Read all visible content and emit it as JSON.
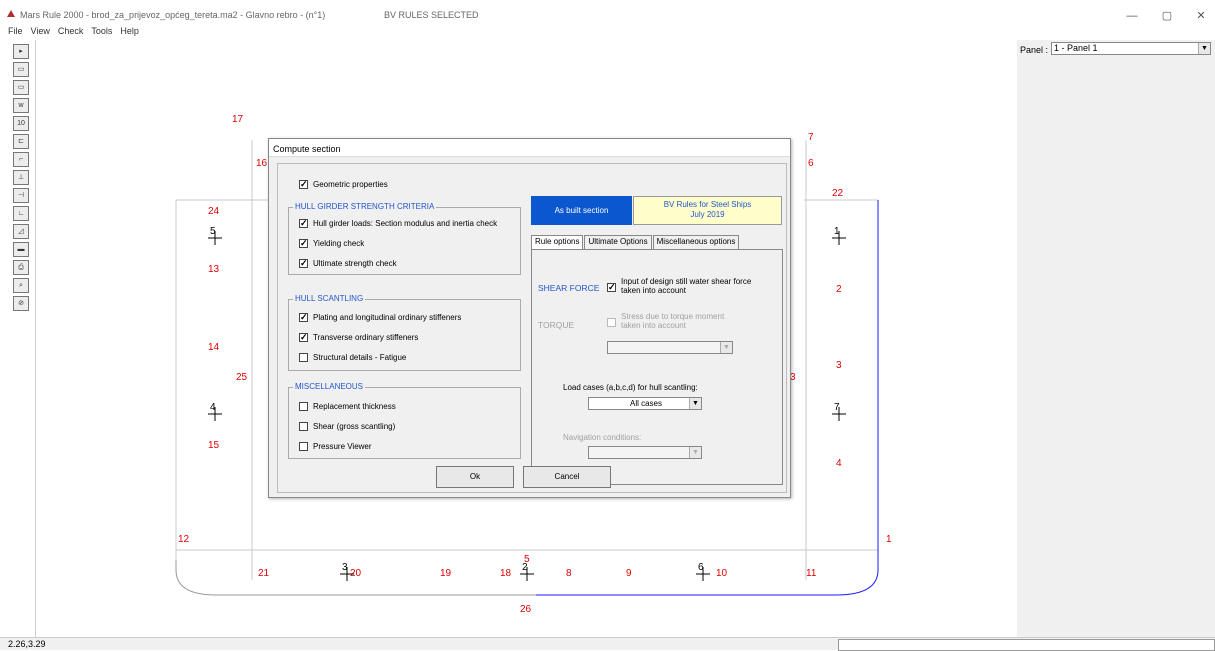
{
  "window": {
    "title": "Mars Rule 2000 - brod_za_prijevoz_općeg_tereta.ma2 - Glavno rebro - (n°1)",
    "rules_selected": "BV RULES SELECTED",
    "minimize": "—",
    "maximize": "▢",
    "close": "✕"
  },
  "menu": [
    "File",
    "View",
    "Check",
    "Tools",
    "Help"
  ],
  "toolbar": {
    "icons": [
      "play-icon",
      "stiffener-icon",
      "stiffener-icon",
      "weight-icon",
      "scale-icon",
      "e-profile-icon",
      "angle-icon",
      "bulb-icon",
      "tee-icon",
      "knee-icon",
      "hull-icon",
      "flat-icon",
      "bracket-icon",
      "box-icon",
      "print-icon",
      "zoom-icon",
      "no-zoom-icon"
    ]
  },
  "panel": {
    "label": "Panel :",
    "value": "1 - Panel 1"
  },
  "status": {
    "coords": "2.26,3.29"
  },
  "drawing": {
    "labels": [
      "17",
      "16",
      "24",
      "5",
      "13",
      "14",
      "25",
      "4",
      "15",
      "12",
      "7",
      "6",
      "22",
      "1",
      "2",
      "3",
      "7",
      "4",
      "1",
      "21",
      "3",
      "20",
      "19",
      "18",
      "2",
      "5",
      "8",
      "9",
      "6",
      "10",
      "11",
      "26",
      "3"
    ]
  },
  "dialog": {
    "title": "Compute section",
    "geometric_properties": "Geometric properties",
    "hull_girder_group": "HULL GIRDER STRENGTH CRITERIA",
    "hull_girder_loads": "Hull girder loads: Section modulus and inertia check",
    "yielding_check": "Yielding check",
    "ultimate_strength_check": "Ultimate strength check",
    "hull_scantling_group": "HULL SCANTLING",
    "plating_stiffeners": "Plating and longitudinal ordinary stiffeners",
    "transverse_stiffeners": "Transverse ordinary stiffeners",
    "structural_details": "Structural details  -  Fatigue",
    "misc_group": "MISCELLANEOUS",
    "replacement_thickness": "Replacement thickness",
    "shear_gross": "Shear (gross scantling)",
    "pressure_viewer": "Pressure Viewer",
    "as_built": "As built section",
    "bv_rules_line1": "BV Rules for Steel Ships",
    "bv_rules_line2": "July 2019",
    "tabs": [
      "Rule options",
      "Ultimate Options",
      "Miscellaneous options"
    ],
    "shear_force_label": "SHEAR FORCE",
    "shear_force_option_l1": "Input of design still water shear force",
    "shear_force_option_l2": "taken into account",
    "torque_label": "TORQUE",
    "torque_option_l1": "Stress due to torque moment",
    "torque_option_l2": "taken into account",
    "load_cases_label": "Load cases (a,b,c,d) for hull scantling:",
    "load_cases_value": "All cases",
    "nav_conditions_label": "Navigation conditions:",
    "ok": "Ok",
    "cancel": "Cancel"
  },
  "checkboxes": {
    "geometric_properties": true,
    "hull_girder_loads": true,
    "yielding_check": true,
    "ultimate_strength_check": true,
    "plating_stiffeners": true,
    "transverse_stiffeners": true,
    "structural_details": false,
    "replacement_thickness": false,
    "shear_gross": false,
    "pressure_viewer": false,
    "shear_force": true,
    "torque": false
  },
  "colors": {
    "accent": "#0b57d0",
    "drawing_red": "#e00000",
    "hull_blue": "#1a1aff",
    "group_title": "#2255cc"
  }
}
